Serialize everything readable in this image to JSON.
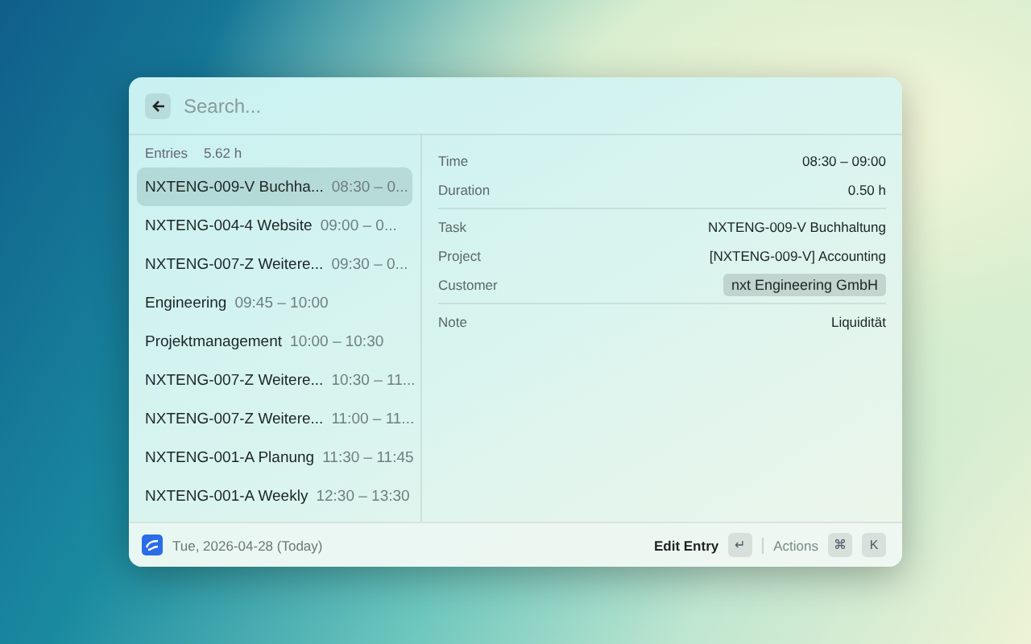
{
  "search": {
    "placeholder": "Search..."
  },
  "list": {
    "title": "Entries",
    "total": "5.62 h",
    "items": [
      {
        "title": "NXTENG-009-V Buchha...",
        "time": "08:30 – 0...",
        "selected": true
      },
      {
        "title": "NXTENG-004-4 Website",
        "time": "09:00 – 0...",
        "selected": false
      },
      {
        "title": "NXTENG-007-Z Weitere...",
        "time": "09:30 – 0...",
        "selected": false
      },
      {
        "title": "Engineering",
        "time": "09:45 – 10:00",
        "selected": false
      },
      {
        "title": "Projektmanagement",
        "time": "10:00 – 10:30",
        "selected": false
      },
      {
        "title": "NXTENG-007-Z Weitere...",
        "time": "10:30 – 11...",
        "selected": false
      },
      {
        "title": "NXTENG-007-Z Weitere...",
        "time": "11:00 – 11...",
        "selected": false
      },
      {
        "title": "NXTENG-001-A Planung",
        "time": "11:30 – 11:45",
        "selected": false
      },
      {
        "title": "NXTENG-001-A Weekly",
        "time": "12:30 – 13:30",
        "selected": false
      }
    ]
  },
  "details": [
    [
      {
        "label": "Time",
        "value": "08:30 – 09:00",
        "kind": "text"
      },
      {
        "label": "Duration",
        "value": "0.50 h",
        "kind": "text"
      }
    ],
    [
      {
        "label": "Task",
        "value": "NXTENG-009-V Buchhaltung",
        "kind": "text"
      },
      {
        "label": "Project",
        "value": "[NXTENG-009-V] Accounting",
        "kind": "text"
      },
      {
        "label": "Customer",
        "value": "nxt Engineering GmbH",
        "kind": "tag"
      }
    ],
    [
      {
        "label": "Note",
        "value": "Liquidität",
        "kind": "text"
      }
    ]
  ],
  "footer": {
    "date": "Tue, 2026-04-28 (Today)",
    "primary_action": {
      "label": "Edit Entry",
      "keys": [
        "↵"
      ]
    },
    "secondary_action": {
      "label": "Actions",
      "keys": [
        "⌘",
        "K"
      ]
    }
  }
}
